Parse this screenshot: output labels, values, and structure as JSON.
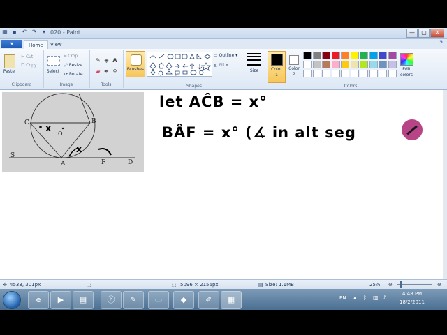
{
  "window": {
    "title_left": "020 - Paint",
    "minimize": "—",
    "maximize": "▢",
    "close": "✕"
  },
  "tabs": {
    "file": "▾",
    "home": "Home",
    "view": "View"
  },
  "clipboard": {
    "paste": "Paste",
    "cut": "Cut",
    "copy": "Copy",
    "label": "Clipboard"
  },
  "image": {
    "select": "Select",
    "crop": "Crop",
    "resize": "Resize",
    "rotate": "Rotate",
    "label": "Image"
  },
  "tools": {
    "label": "Tools"
  },
  "brushes": {
    "label": "Brushes"
  },
  "shapes": {
    "outline": "Outline",
    "fill": "Fill",
    "label": "Shapes"
  },
  "size": {
    "label": "Size"
  },
  "color1": {
    "label1": "Color",
    "label2": "1"
  },
  "color2": {
    "label1": "Color",
    "label2": "2"
  },
  "colors": {
    "label": "Colors",
    "edit1": "Edit",
    "edit2": "colors",
    "row1": [
      "#000000",
      "#7f7f7f",
      "#880015",
      "#ed1c24",
      "#ff7f27",
      "#fff200",
      "#22b14c",
      "#00a2e8",
      "#3f48cc",
      "#a349a4"
    ],
    "row2": [
      "#ffffff",
      "#c3c3c3",
      "#b97a57",
      "#ffaec9",
      "#ffc90e",
      "#efe4b0",
      "#b5e61d",
      "#99d9ea",
      "#7092be",
      "#c8bfe7"
    ],
    "row3": [
      "#ffffff",
      "#ffffff",
      "#ffffff",
      "#ffffff",
      "#ffffff",
      "#ffffff",
      "#ffffff",
      "#ffffff",
      "#ffffff",
      "#ffffff"
    ]
  },
  "canvas": {
    "line1": "let  AĈB = x°",
    "line2": "BÂF = x° (∡ in alt seg",
    "photo_labels": {
      "C": "C",
      "B": "B",
      "O": "O",
      "x1": "x",
      "x2": "x",
      "S": "S",
      "A": "A",
      "F": "F",
      "D": "D"
    }
  },
  "status": {
    "cursor": "4533, 301px",
    "dimensions": "5096 × 2156px",
    "size": "Size: 1.1MB",
    "zoom": "25%"
  },
  "taskbar": {
    "lang": "EN",
    "time": "4:48 PM",
    "date": "18/2/2011"
  }
}
